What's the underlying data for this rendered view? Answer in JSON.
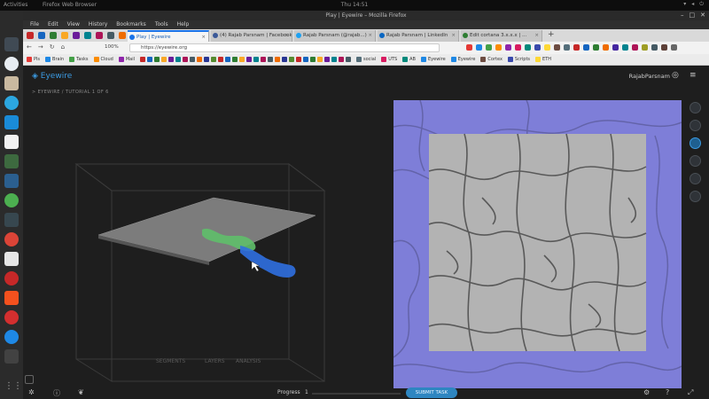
{
  "os": {
    "topbar_left": "Activities",
    "topbar_app": "Firefox Web Browser",
    "topbar_time": "Thu 14:51"
  },
  "window": {
    "title": "Play | Eyewire – Mozilla Firefox",
    "menu": [
      "File",
      "Edit",
      "View",
      "History",
      "Bookmarks",
      "Tools",
      "Help"
    ]
  },
  "tabs": [
    {
      "label": "Play | Eyewire",
      "active": true,
      "color": "#1a73e8"
    },
    {
      "label": "(4) Rajab Parsnam | Facebook",
      "active": false,
      "color": "#3b5998"
    },
    {
      "label": "Rajab Parsnam (@rajab...)",
      "active": false,
      "color": "#1da1f2"
    },
    {
      "label": "Rajab Parsnam | LinkedIn",
      "active": false,
      "color": "#0a66c2"
    },
    {
      "label": "Edit cortana 3.x.x.x | ...",
      "active": false,
      "color": "#2e7d32"
    }
  ],
  "urlbar": {
    "url": "https://eyewire.org",
    "zoom": "100%"
  },
  "bookmarks": [
    {
      "label": "Pls",
      "color": "#e53935"
    },
    {
      "label": "Brain",
      "color": "#1e88e5"
    },
    {
      "label": "Tasks",
      "color": "#43a047"
    },
    {
      "label": "Cloud",
      "color": "#fb8c00"
    },
    {
      "label": "Mail",
      "color": "#8e24aa"
    },
    {
      "label": "social",
      "color": "#546e7a"
    },
    {
      "label": "UTS",
      "color": "#d81b60"
    },
    {
      "label": "AB",
      "color": "#00897b"
    },
    {
      "label": "Eyewire",
      "color": "#1e88e5"
    },
    {
      "label": "Eyewire",
      "color": "#1e88e5"
    },
    {
      "label": "Cortex",
      "color": "#6d4c41"
    },
    {
      "label": "Scripts",
      "color": "#3949ab"
    },
    {
      "label": "ETH",
      "color": "#fdd835"
    }
  ],
  "app": {
    "brand": "Eyewire",
    "breadcrumb": "> EYEWIRE / TUTORIAL 1 OF 6",
    "user": "RajabParsnam",
    "cube_labels": [
      "SEGMENTS",
      "LAYERS",
      "ANALYSIS"
    ]
  },
  "bottom": {
    "progress_label": "Progress",
    "progress_value": "1",
    "submit_label": "SUBMIT TASK"
  },
  "colors": {
    "accent": "#3b9ae1",
    "submit": "#2e86c1",
    "overlay": "#7e7ed8",
    "segment_green": "#5fbf6a",
    "segment_blue": "#2f6fe0"
  }
}
